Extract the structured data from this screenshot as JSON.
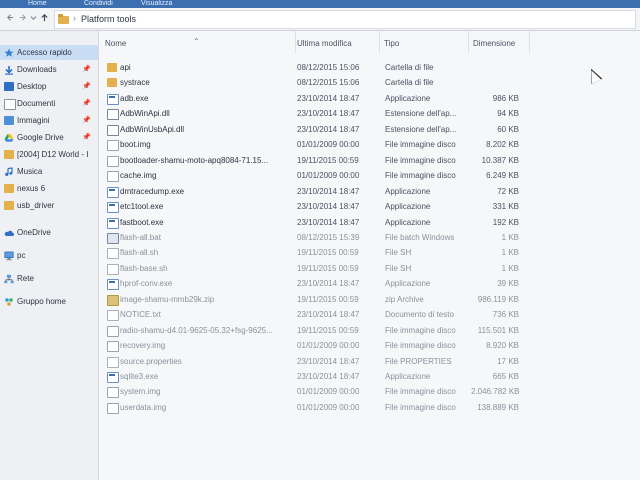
{
  "ribbon": {
    "tabs": [
      "Home",
      "Condividi",
      "Visualizza"
    ]
  },
  "address_bar": {
    "back_icon": "arrow-left-icon",
    "forward_icon": "arrow-right-icon",
    "recent_icon": "chevron-down-icon",
    "up_icon": "arrow-up-icon",
    "separator": "›",
    "path": "Platform tools"
  },
  "sidebar": {
    "items": [
      {
        "label": "Accesso rapido",
        "icon": "star-icon",
        "pinned": false,
        "selected": true
      },
      {
        "label": "Downloads",
        "icon": "download-icon",
        "pinned": true
      },
      {
        "label": "Desktop",
        "icon": "desktop-icon",
        "pinned": true
      },
      {
        "label": "Documenti",
        "icon": "documents-icon",
        "pinned": true
      },
      {
        "label": "Immagini",
        "icon": "pictures-icon",
        "pinned": true
      },
      {
        "label": "Google Drive",
        "icon": "google-drive-icon",
        "pinned": true
      },
      {
        "label": "[2004] D12 World - I",
        "icon": "folder-icon",
        "pinned": false
      },
      {
        "label": "Musica",
        "icon": "music-icon",
        "pinned": false
      },
      {
        "label": "nexus 6",
        "icon": "folder-icon",
        "pinned": false
      },
      {
        "label": "usb_driver",
        "icon": "folder-icon",
        "pinned": false
      },
      {
        "label": "OneDrive",
        "icon": "onedrive-icon",
        "pinned": false
      },
      {
        "label": "pc",
        "icon": "computer-icon",
        "pinned": false
      },
      {
        "label": "Rete",
        "icon": "network-icon",
        "pinned": false
      },
      {
        "label": "Gruppo home",
        "icon": "homegroup-icon",
        "pinned": false
      }
    ]
  },
  "columns": {
    "name": "Nome",
    "modified": "Ultima modifica",
    "type": "Tipo",
    "size": "Dimensione"
  },
  "files": [
    {
      "name": "api",
      "modified": "08/12/2015 15:06",
      "type": "Cartella di file",
      "size": "",
      "icon": "folder-icon"
    },
    {
      "name": "systrace",
      "modified": "08/12/2015 15:06",
      "type": "Cartella di file",
      "size": "",
      "icon": "folder-icon"
    },
    {
      "name": "adb.exe",
      "modified": "23/10/2014 18:47",
      "type": "Applicazione",
      "size": "986 KB",
      "icon": "exe-icon"
    },
    {
      "name": "AdbWinApi.dll",
      "modified": "23/10/2014 18:47",
      "type": "Estensione dell'ap...",
      "size": "94 KB",
      "icon": "dll-icon"
    },
    {
      "name": "AdbWinUsbApi.dll",
      "modified": "23/10/2014 18:47",
      "type": "Estensione dell'ap...",
      "size": "60 KB",
      "icon": "dll-icon"
    },
    {
      "name": "boot.img",
      "modified": "01/01/2009 00:00",
      "type": "File immagine disco",
      "size": "8.202 KB",
      "icon": "disk-image-icon"
    },
    {
      "name": "bootloader-shamu-moto-apq8084-71.15...",
      "modified": "19/11/2015 00:59",
      "type": "File immagine disco",
      "size": "10.387 KB",
      "icon": "disk-image-icon"
    },
    {
      "name": "cache.img",
      "modified": "01/01/2009 00:00",
      "type": "File immagine disco",
      "size": "6.249 KB",
      "icon": "disk-image-icon"
    },
    {
      "name": "dmtracedump.exe",
      "modified": "23/10/2014 18:47",
      "type": "Applicazione",
      "size": "72 KB",
      "icon": "exe-icon"
    },
    {
      "name": "etc1tool.exe",
      "modified": "23/10/2014 18:47",
      "type": "Applicazione",
      "size": "331 KB",
      "icon": "exe-icon"
    },
    {
      "name": "fastboot.exe",
      "modified": "23/10/2014 18:47",
      "type": "Applicazione",
      "size": "192 KB",
      "icon": "exe-icon"
    },
    {
      "name": "flash-all.bat",
      "modified": "08/12/2015 15:39",
      "type": "File batch Windows",
      "size": "1 KB",
      "icon": "batch-file-icon"
    },
    {
      "name": "flash-all.sh",
      "modified": "19/11/2015 00:59",
      "type": "File SH",
      "size": "1 KB",
      "icon": "file-icon"
    },
    {
      "name": "flash-base.sh",
      "modified": "19/11/2015 00:59",
      "type": "File SH",
      "size": "1 KB",
      "icon": "file-icon"
    },
    {
      "name": "hprof-conv.exe",
      "modified": "23/10/2014 18:47",
      "type": "Applicazione",
      "size": "39 KB",
      "icon": "exe-icon"
    },
    {
      "name": "image-shamu-mmb29k.zip",
      "modified": "19/11/2015 00:59",
      "type": "zip Archive",
      "size": "986.119 KB",
      "icon": "zip-icon"
    },
    {
      "name": "NOTICE.txt",
      "modified": "23/10/2014 18:47",
      "type": "Documento di testo",
      "size": "736 KB",
      "icon": "text-file-icon"
    },
    {
      "name": "radio-shamu-d4.01-9625-05.32+fsg-9625...",
      "modified": "19/11/2015 00:59",
      "type": "File immagine disco",
      "size": "115.501 KB",
      "icon": "disk-image-icon"
    },
    {
      "name": "recovery.img",
      "modified": "01/01/2009 00:00",
      "type": "File immagine disco",
      "size": "8.920 KB",
      "icon": "disk-image-icon"
    },
    {
      "name": "source.properties",
      "modified": "23/10/2014 18:47",
      "type": "File PROPERTIES",
      "size": "17 KB",
      "icon": "file-icon"
    },
    {
      "name": "sqlite3.exe",
      "modified": "23/10/2014 18:47",
      "type": "Applicazione",
      "size": "665 KB",
      "icon": "exe-icon"
    },
    {
      "name": "system.img",
      "modified": "01/01/2009 00:00",
      "type": "File immagine disco",
      "size": "2.046.782 KB",
      "icon": "disk-image-icon"
    },
    {
      "name": "userdata.img",
      "modified": "01/01/2009 00:00",
      "type": "File immagine disco",
      "size": "138.889 KB",
      "icon": "disk-image-icon"
    }
  ],
  "colors": {
    "ribbon": "#3b6fb0",
    "folder": "#e3b04b",
    "selection": "#c9def4"
  }
}
